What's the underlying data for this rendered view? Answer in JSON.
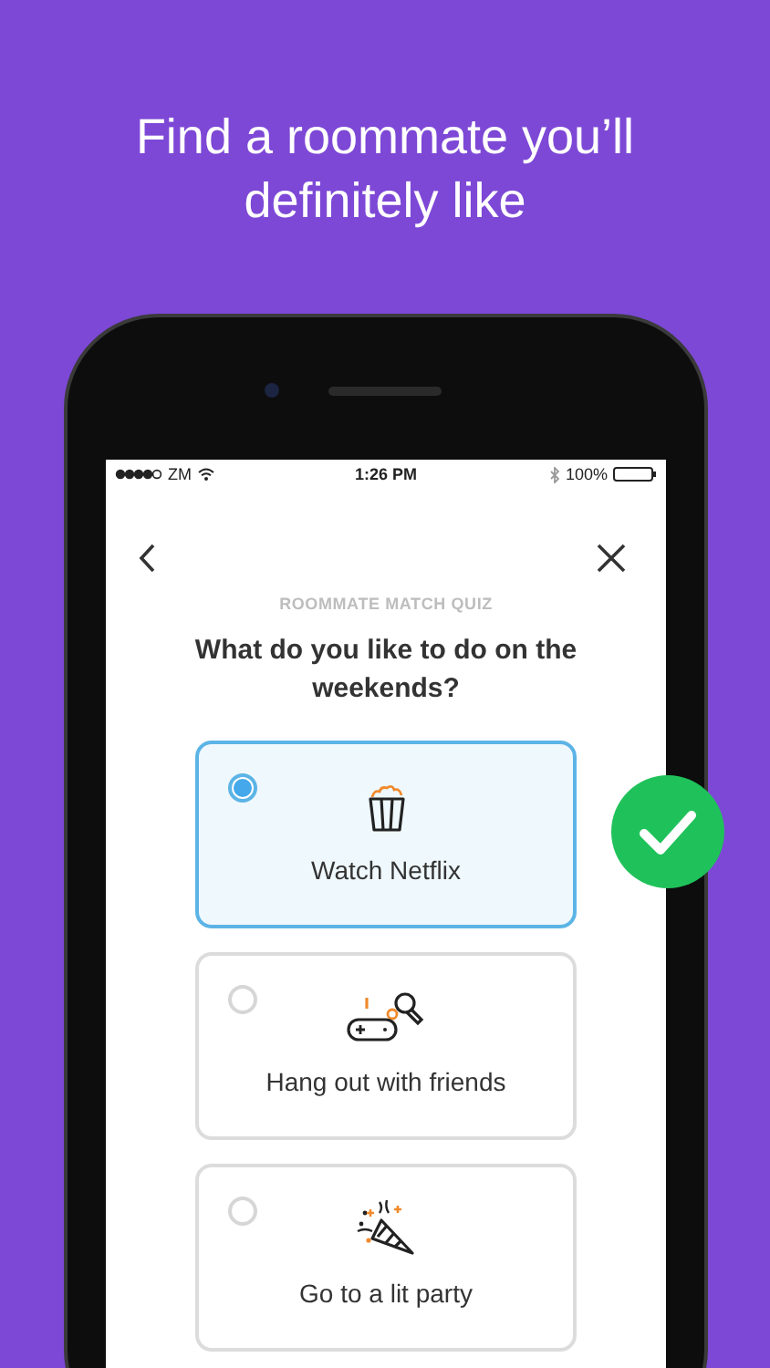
{
  "headline": "Find a roommate you’ll definitely like",
  "status_bar": {
    "carrier": "ZM",
    "time": "1:26 PM",
    "battery": "100%"
  },
  "quiz": {
    "label": "ROOMMATE MATCH QUIZ",
    "question": "What do you like to do on the weekends?"
  },
  "options": [
    {
      "label": "Watch Netflix",
      "selected": true,
      "kind": "popcorn"
    },
    {
      "label": "Hang out with friends",
      "selected": false,
      "kind": "games"
    },
    {
      "label": "Go to a lit party",
      "selected": false,
      "kind": "party"
    }
  ],
  "answer_badge": {
    "kind": "check"
  }
}
